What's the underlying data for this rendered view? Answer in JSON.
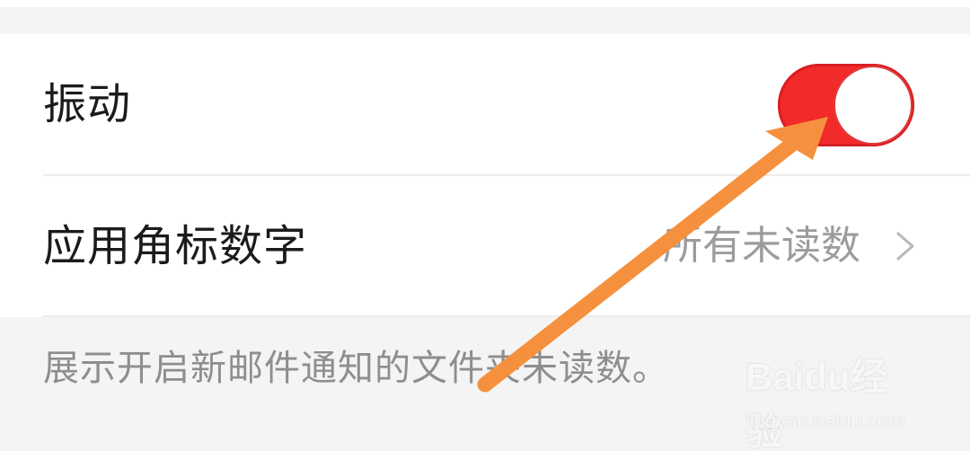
{
  "settings": {
    "vibration": {
      "label": "振动",
      "enabled": true
    },
    "badge_number": {
      "label": "应用角标数字",
      "value": "所有未读数"
    },
    "note": "展示开启新邮件通知的文件夹未读数。"
  },
  "colors": {
    "toggle_on": "#f22a2a",
    "label": "#1b1b1b",
    "secondary": "#9c9c9c",
    "annotation_arrow": "#f5913e"
  },
  "icons": {
    "chevron": "chevron-right-icon"
  },
  "watermark": {
    "logo": "Baidu经验",
    "url": "jingyan.baidu.com"
  }
}
